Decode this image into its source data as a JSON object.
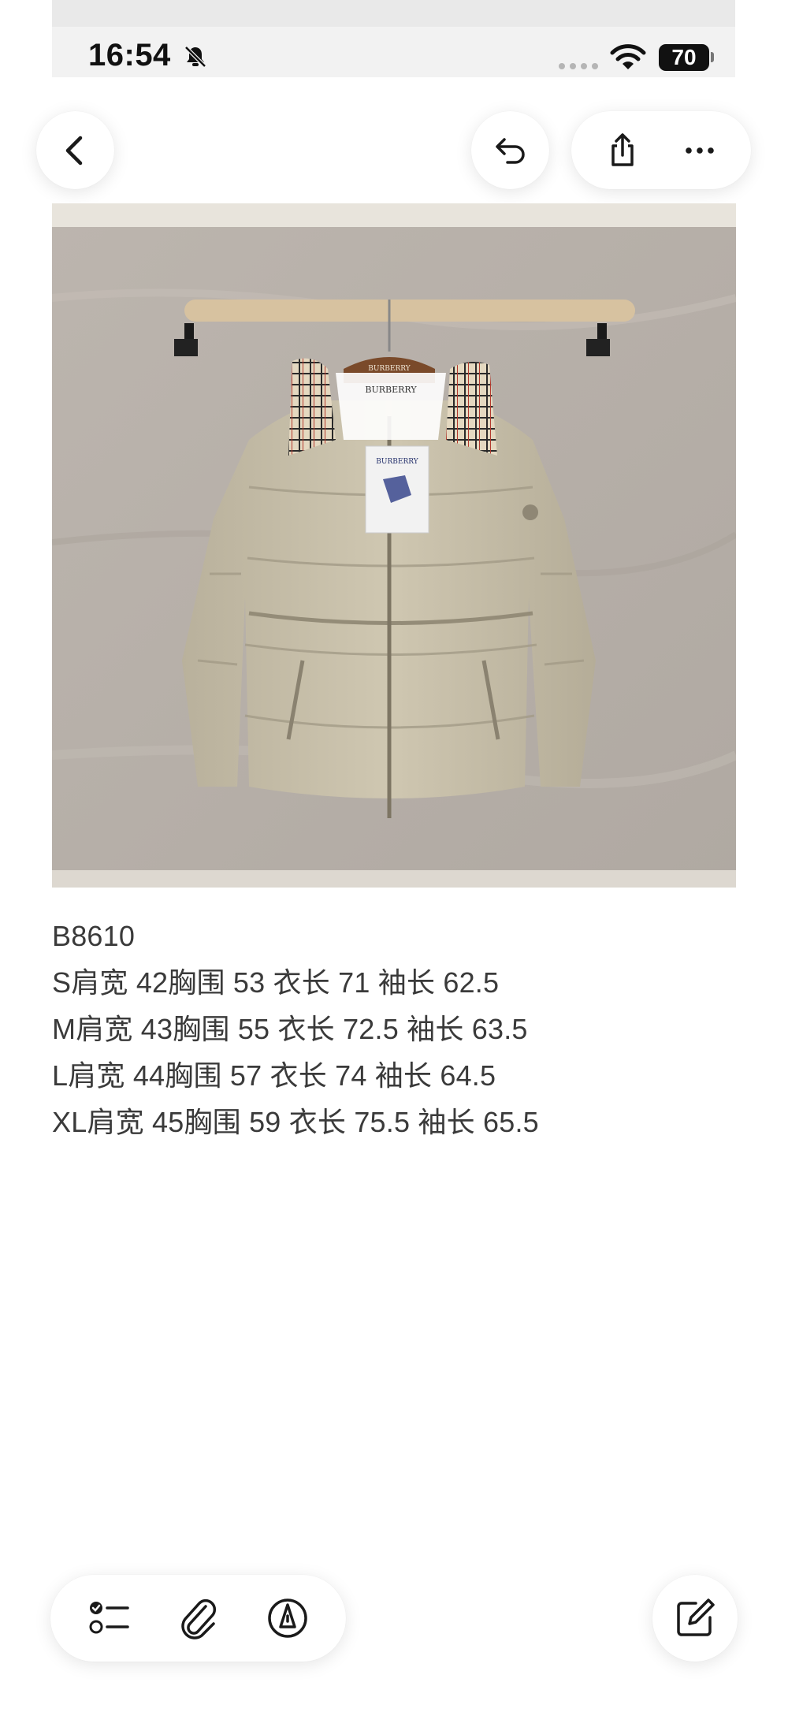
{
  "status_bar": {
    "time": "16:54",
    "battery": "70",
    "icons": [
      "bell-slash-icon",
      "signal-dots-icon",
      "wifi-icon",
      "battery-icon"
    ]
  },
  "nav": {
    "back_icon": "chevron-left-icon",
    "undo_icon": "undo-arrow-icon",
    "share_icon": "share-icon",
    "more_icon": "ellipsis-icon"
  },
  "photo": {
    "hanger_label": "BURBERRY",
    "tag_label": "BURBERRY",
    "inner_label": "BURBERRY"
  },
  "note": {
    "lines": [
      "B8610",
      "S肩宽 42胸围 53 衣长 71 袖长 62.5",
      "M肩宽 43胸围 55 衣长 72.5 袖长 63.5",
      "L肩宽 44胸围 57 衣长 74 袖长 64.5",
      "XL肩宽 45胸围 59 衣长 75.5 袖长 65.5"
    ]
  },
  "toolbar": {
    "checklist_icon": "checklist-icon",
    "attachment_icon": "paperclip-icon",
    "markup_icon": "pen-markup-icon",
    "compose_icon": "compose-icon"
  }
}
